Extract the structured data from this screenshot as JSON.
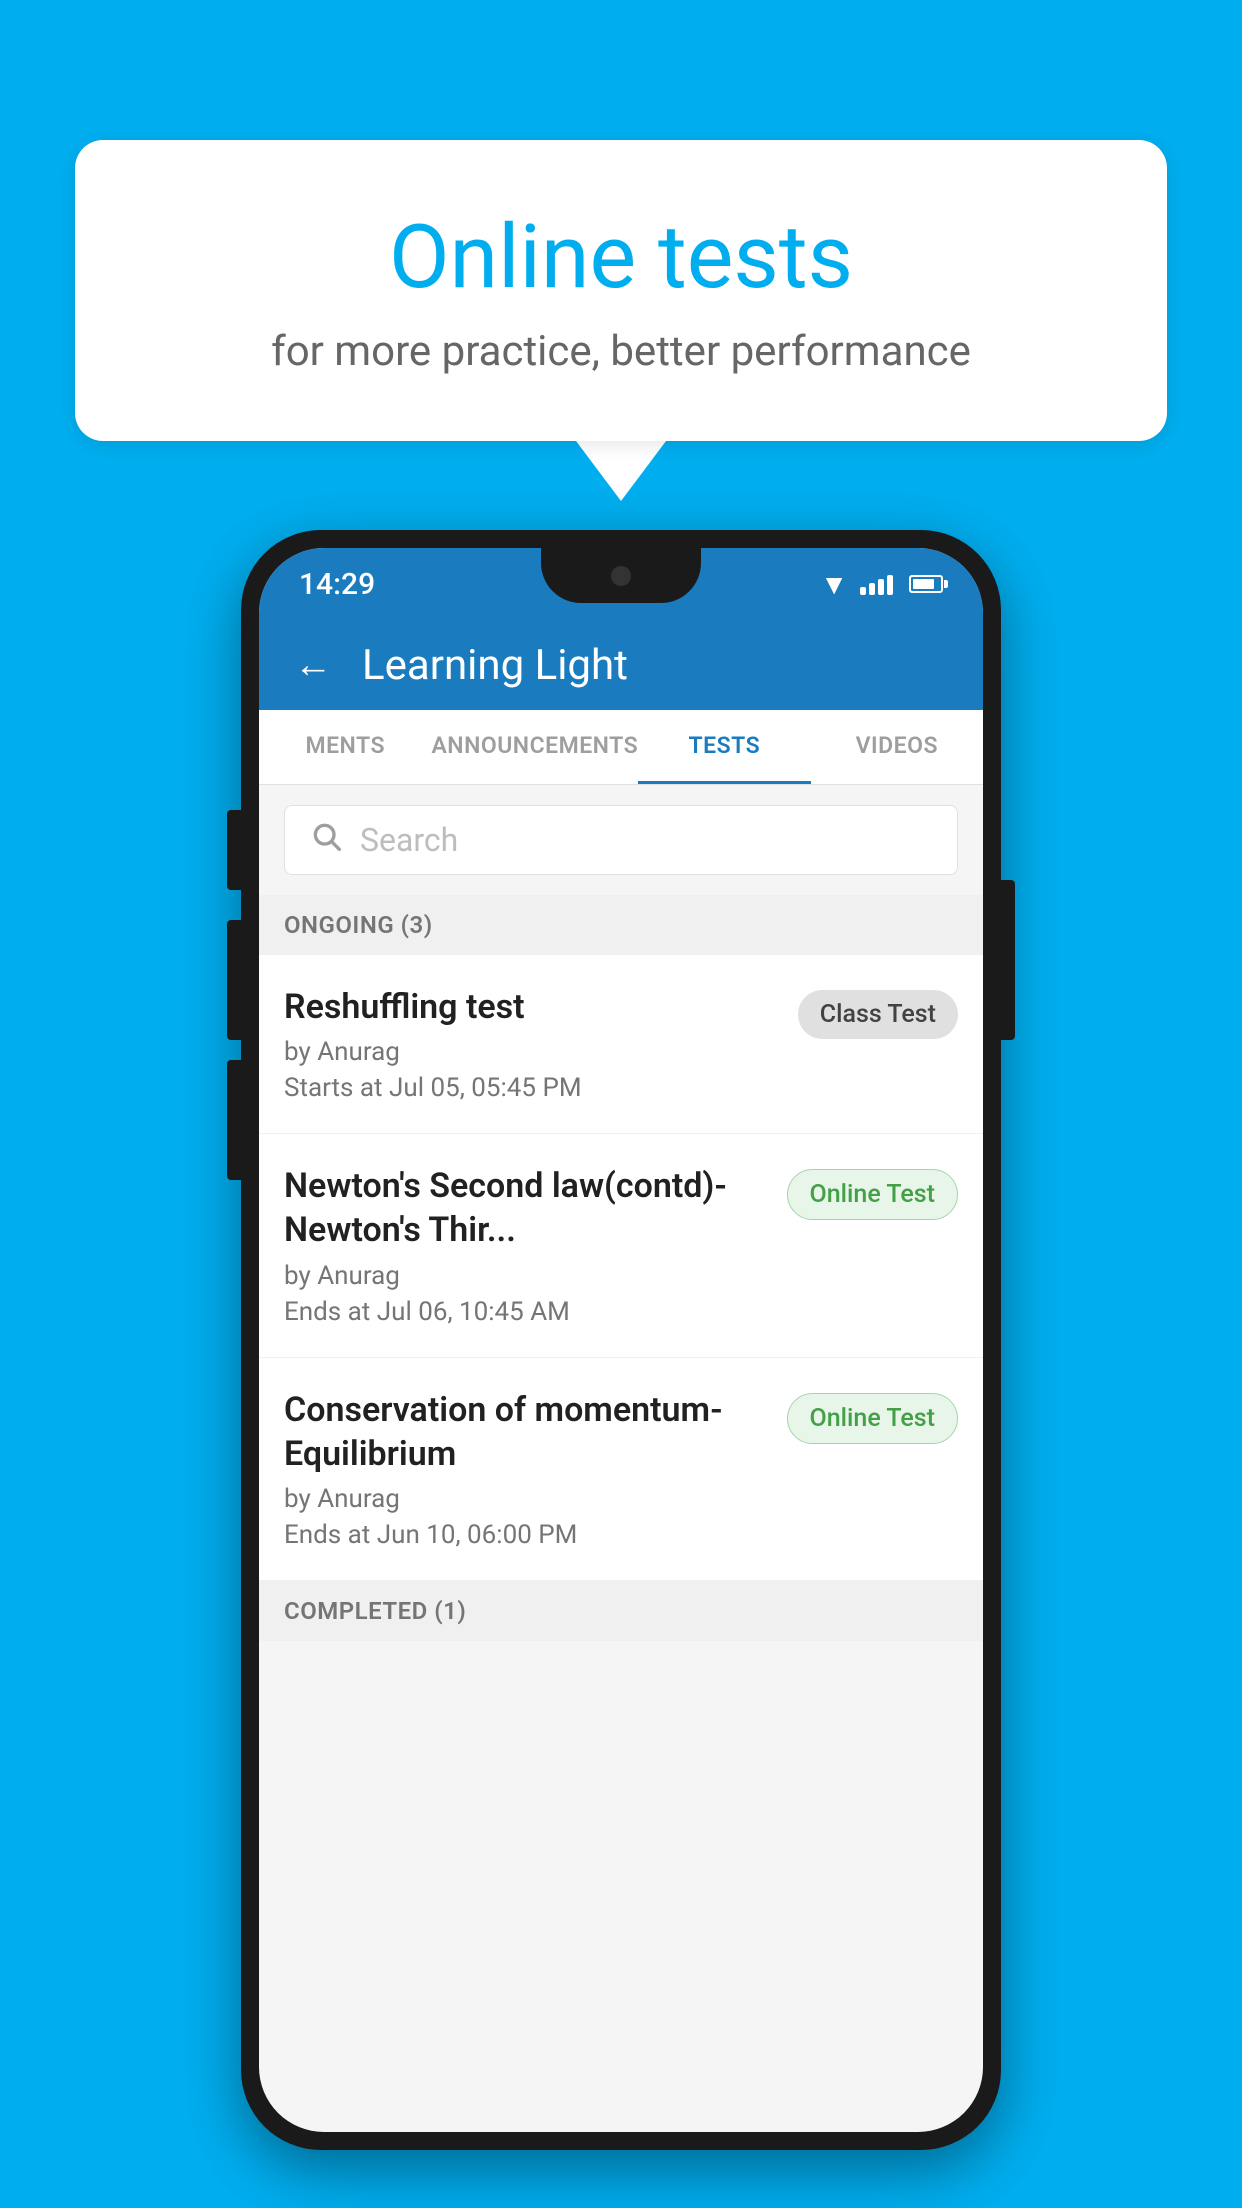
{
  "background_color": "#00AEEF",
  "speech_bubble": {
    "title": "Online tests",
    "subtitle": "for more practice, better performance"
  },
  "status_bar": {
    "time": "14:29"
  },
  "app_header": {
    "title": "Learning Light",
    "back_label": "←"
  },
  "tabs": [
    {
      "id": "ments",
      "label": "MENTS",
      "active": false
    },
    {
      "id": "announcements",
      "label": "ANNOUNCEMENTS",
      "active": false
    },
    {
      "id": "tests",
      "label": "TESTS",
      "active": true
    },
    {
      "id": "videos",
      "label": "VIDEOS",
      "active": false
    }
  ],
  "search": {
    "placeholder": "Search"
  },
  "section_ongoing": {
    "label": "ONGOING (3)"
  },
  "tests": [
    {
      "name": "Reshuffling test",
      "author": "by Anurag",
      "time_label": "Starts at",
      "time": "Jul 05, 05:45 PM",
      "badge": "Class Test",
      "badge_type": "class"
    },
    {
      "name": "Newton's Second law(contd)-Newton's Thir...",
      "author": "by Anurag",
      "time_label": "Ends at",
      "time": "Jul 06, 10:45 AM",
      "badge": "Online Test",
      "badge_type": "online"
    },
    {
      "name": "Conservation of momentum-Equilibrium",
      "author": "by Anurag",
      "time_label": "Ends at",
      "time": "Jun 10, 06:00 PM",
      "badge": "Online Test",
      "badge_type": "online"
    }
  ],
  "section_completed": {
    "label": "COMPLETED (1)"
  }
}
